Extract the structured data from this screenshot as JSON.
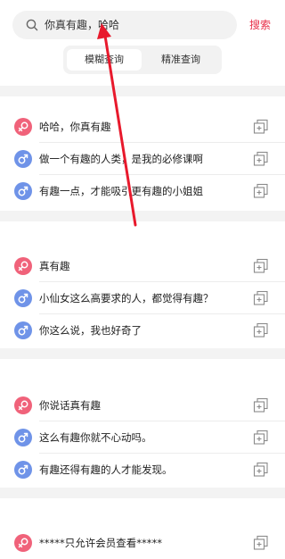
{
  "search": {
    "query": "你真有趣，哈哈",
    "button_label": "搜索"
  },
  "tabs": [
    {
      "label": "模糊查询",
      "active": true
    },
    {
      "label": "精准查询",
      "active": false
    }
  ],
  "groups": [
    {
      "items": [
        {
          "gender": "female",
          "text": "哈哈，你真有趣"
        },
        {
          "gender": "male",
          "text": "做一个有趣的人类，是我的必修课啊"
        },
        {
          "gender": "male",
          "text": "有趣一点，才能吸引更有趣的小姐姐"
        }
      ]
    },
    {
      "items": [
        {
          "gender": "female",
          "text": "真有趣"
        },
        {
          "gender": "male",
          "text": "小仙女这么高要求的人，都觉得有趣？"
        },
        {
          "gender": "male",
          "text": "你这么说，我也好奇了"
        }
      ]
    },
    {
      "items": [
        {
          "gender": "female",
          "text": "你说话真有趣"
        },
        {
          "gender": "male",
          "text": "这么有趣你就不心动吗。"
        },
        {
          "gender": "male",
          "text": "有趣还得有趣的人才能发现。"
        }
      ]
    },
    {
      "items": [
        {
          "gender": "female",
          "text": "*****只允许会员查看*****"
        }
      ]
    }
  ],
  "colors": {
    "accent": "#e8314a",
    "female": "#f0627a",
    "male": "#6f93e8",
    "annotation_arrow": "#e8192c"
  },
  "icons": [
    "search-icon",
    "female-icon",
    "male-icon",
    "copy-icon"
  ]
}
